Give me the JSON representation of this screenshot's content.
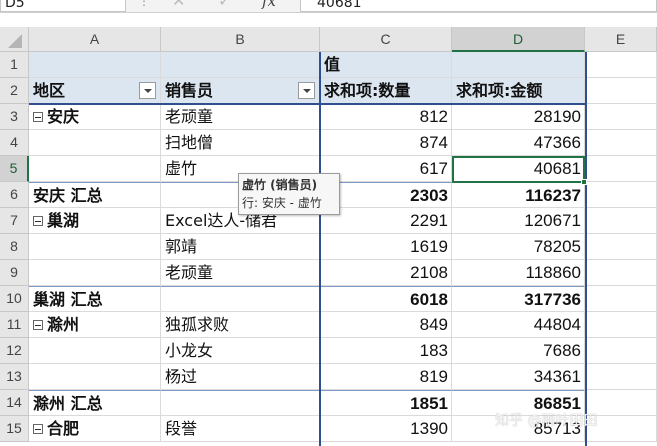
{
  "formula_bar": {
    "name_box": "D5",
    "value": "40681"
  },
  "columns": [
    "A",
    "B",
    "C",
    "D",
    "E"
  ],
  "selected_column": "D",
  "rows": [
    {
      "n": "1",
      "a": "",
      "b": "",
      "c": "值",
      "d": "",
      "type": "header1"
    },
    {
      "n": "2",
      "a": "地区",
      "b": "销售员",
      "c": "求和项:数量",
      "d": "求和项:金额",
      "type": "header2"
    },
    {
      "n": "3",
      "a": "安庆",
      "b": "老顽童",
      "c": "812",
      "d": "28190",
      "type": "group"
    },
    {
      "n": "4",
      "a": "",
      "b": "扫地僧",
      "c": "874",
      "d": "47366",
      "type": "item"
    },
    {
      "n": "5",
      "a": "",
      "b": "虚竹",
      "c": "617",
      "d": "40681",
      "type": "item"
    },
    {
      "n": "6",
      "a": "安庆 汇总",
      "b": "",
      "c": "2303",
      "d": "116237",
      "type": "subtotal"
    },
    {
      "n": "7",
      "a": "巢湖",
      "b": "Excel达人-储君",
      "c": "2291",
      "d": "120671",
      "type": "group"
    },
    {
      "n": "8",
      "a": "",
      "b": "郭靖",
      "c": "1619",
      "d": "78205",
      "type": "item"
    },
    {
      "n": "9",
      "a": "",
      "b": "老顽童",
      "c": "2108",
      "d": "118860",
      "type": "item"
    },
    {
      "n": "10",
      "a": "巢湖 汇总",
      "b": "",
      "c": "6018",
      "d": "317736",
      "type": "subtotal"
    },
    {
      "n": "11",
      "a": "滁州",
      "b": "独孤求败",
      "c": "849",
      "d": "44804",
      "type": "group"
    },
    {
      "n": "12",
      "a": "",
      "b": "小龙女",
      "c": "183",
      "d": "7686",
      "type": "item"
    },
    {
      "n": "13",
      "a": "",
      "b": "杨过",
      "c": "819",
      "d": "34361",
      "type": "item"
    },
    {
      "n": "14",
      "a": "滁州 汇总",
      "b": "",
      "c": "1851",
      "d": "86851",
      "type": "subtotal"
    },
    {
      "n": "15",
      "a": "合肥",
      "b": "段誉",
      "c": "1390",
      "d": "85713",
      "type": "group"
    }
  ],
  "selected_row": "5",
  "tooltip": {
    "title": "虚竹 (销售员)",
    "detail": "行: 安庆 - 虚竹"
  },
  "watermark": "知乎 @雨叶田田",
  "colors": {
    "accent": "#217346",
    "pivot_header_bg": "#dce6f1",
    "pivot_border": "#2f4f8f"
  }
}
